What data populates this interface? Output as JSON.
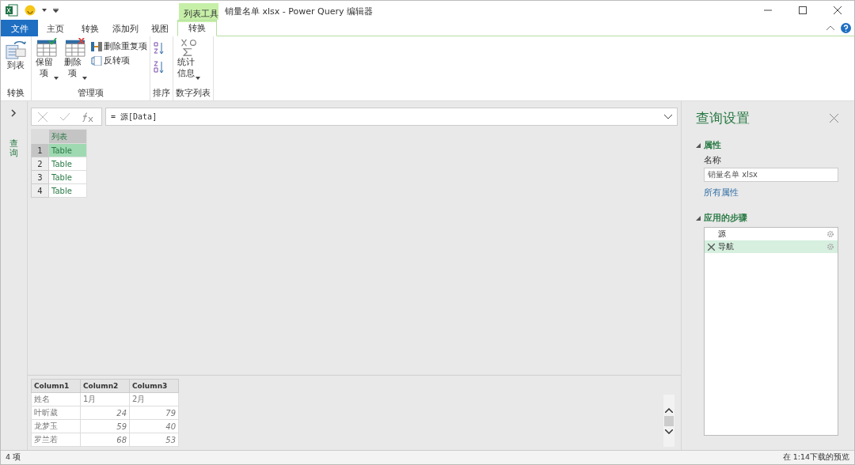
{
  "window": {
    "title": "销量名单 xlsx - Power Query 编辑器",
    "context_tab_group": "列表工具"
  },
  "tabs": [
    {
      "label": "文件",
      "kind": "file",
      "selected": false
    },
    {
      "label": "主页",
      "kind": "tab",
      "selected": false
    },
    {
      "label": "转换",
      "kind": "tab",
      "selected": false
    },
    {
      "label": "添加列",
      "kind": "tab",
      "selected": false
    },
    {
      "label": "视图",
      "kind": "tab",
      "selected": false
    },
    {
      "label": "转换",
      "kind": "context",
      "selected": true
    }
  ],
  "ribbon_groups": [
    {
      "label": "转换",
      "buttons": [
        {
          "kind": "large",
          "label": "到表",
          "dropdown": false
        }
      ]
    },
    {
      "label": "管理项",
      "buttons": [
        {
          "kind": "large",
          "label": "保留项",
          "dropdown": true
        },
        {
          "kind": "large",
          "label": "删除项",
          "dropdown": true
        },
        {
          "kind": "small",
          "label": "删除重复项"
        },
        {
          "kind": "small",
          "label": "反转项"
        }
      ]
    },
    {
      "label": "排序",
      "buttons": [
        {
          "kind": "icon"
        },
        {
          "kind": "icon"
        }
      ]
    },
    {
      "label": "数字列表",
      "buttons": [
        {
          "kind": "large",
          "label": "统计信息",
          "dropdown": true
        }
      ]
    }
  ],
  "queries_pane": {
    "label": "查询"
  },
  "formula_bar": {
    "value": "= 源[Data]"
  },
  "list_table": {
    "columns": [
      "列表"
    ],
    "rows": [
      {
        "index": "1",
        "value": "Table",
        "selected": true
      },
      {
        "index": "2",
        "value": "Table",
        "selected": false
      },
      {
        "index": "3",
        "value": "Table",
        "selected": false
      },
      {
        "index": "4",
        "value": "Table",
        "selected": false
      }
    ]
  },
  "preview_table": {
    "columns": [
      "Column1",
      "Column2",
      "Column3"
    ],
    "rows": [
      {
        "cells": [
          {
            "text": "姓名",
            "kind": "text"
          },
          {
            "text": "1月",
            "kind": "text"
          },
          {
            "text": "2月",
            "kind": "text"
          }
        ]
      },
      {
        "cells": [
          {
            "text": "叶昕葳",
            "kind": "text"
          },
          {
            "text": "24",
            "kind": "number"
          },
          {
            "text": "79",
            "kind": "number"
          }
        ]
      },
      {
        "cells": [
          {
            "text": "龙梦玉",
            "kind": "text"
          },
          {
            "text": "59",
            "kind": "number"
          },
          {
            "text": "40",
            "kind": "number"
          }
        ]
      },
      {
        "cells": [
          {
            "text": "罗兰若",
            "kind": "text"
          },
          {
            "text": "68",
            "kind": "number"
          },
          {
            "text": "53",
            "kind": "number"
          }
        ]
      }
    ]
  },
  "query_settings": {
    "title": "查询设置",
    "properties_heading": "属性",
    "name_label": "名称",
    "name_value": "销量名单 xlsx",
    "all_properties_link": "所有属性",
    "steps_heading": "应用的步骤",
    "steps": [
      {
        "label": "源",
        "selected": false,
        "deletable": false
      },
      {
        "label": "导航",
        "selected": true,
        "deletable": true
      }
    ]
  },
  "status_bar": {
    "left": "4 项",
    "right": "在 1:14下载的预览"
  }
}
